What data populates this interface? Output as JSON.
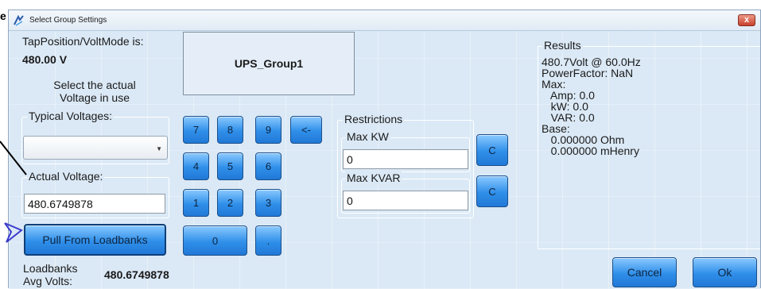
{
  "annotation": {
    "marker": "e"
  },
  "window": {
    "title": "Select Group Settings",
    "close_label": "x"
  },
  "left": {
    "tap_label": "TapPosition/VoltMode is:",
    "tap_value": "480.00 V",
    "select_line1": "Select the actual",
    "select_line2": "Voltage in use",
    "typical_label": "Typical Voltages:",
    "typical_selected": "",
    "actual_label": "Actual Voltage:",
    "actual_value": "480.6749878",
    "pull_button": "Pull From Loadbanks",
    "loadbanks_line1": "Loadbanks",
    "loadbanks_line2": "Avg Volts:",
    "avg_volts": "480.6749878"
  },
  "group_name": "UPS_Group1",
  "keypad": {
    "k7": "7",
    "k8": "8",
    "k9": "9",
    "back": "<-",
    "k4": "4",
    "k5": "5",
    "k6": "6",
    "k1": "1",
    "k2": "2",
    "k3": "3",
    "k0": "0",
    "dot": "."
  },
  "restrictions": {
    "title": "Restrictions",
    "max_kw_label": "Max KW",
    "max_kw_value": "0",
    "max_kvar_label": "Max KVAR",
    "max_kvar_value": "0",
    "clear_label": "C"
  },
  "results": {
    "title": "Results",
    "lines": "480.7Volt @ 60.0Hz\nPowerFactor: NaN\nMax:\n   Amp: 0.0\n   kW: 0.0\n   VAR: 0.0\nBase:\n   0.000000 Ohm\n   0.000000 mHenry"
  },
  "footer": {
    "cancel": "Cancel",
    "ok": "Ok"
  },
  "colors": {
    "accent_blue": "#2f8fe9",
    "background": "#dbe9f6",
    "close_red": "#c8402b"
  }
}
